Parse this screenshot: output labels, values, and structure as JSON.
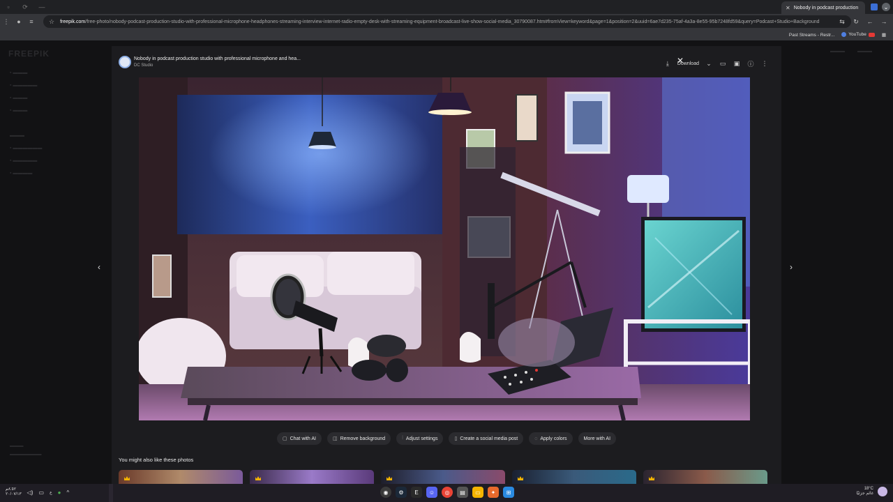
{
  "browser": {
    "active_tab": "Nobody in podcast production",
    "url_host": "freepik.com",
    "url_path": "/free-photo/nobody-podcast-production-studio-with-professional-microphone-headphones-streaming-interview-internet-radio-empty-desk-with-streaming-equipment-broadcast-live-show-social-media_30790087.htm#fromView=keyword&page=1&position=2&uuid=6ae7d235-75af-4a3a-8e55-95b7248fd59&query=Podcast+Studio+Background",
    "bookmarks": [
      "Past Streams - Restr...",
      "YouTube"
    ]
  },
  "modal": {
    "title": "Nobody in podcast production studio with professional microphone and hea...",
    "author": "DC Studio",
    "download_label": "Download",
    "ai_actions": [
      "Chat with AI",
      "Remove background",
      "Adjust settings",
      "Create a social media post",
      "Apply colors",
      "More with AI"
    ],
    "related_heading": "You might also like these photos"
  },
  "taskbar": {
    "clock_time": "٨:٥٢م",
    "clock_date": "٢٠/٠٧/١٣",
    "lang": "ع",
    "weather_temp": "18°C",
    "weather_desc": "غائم جزئيًا"
  },
  "colors": {
    "accent": "#3b6fd6",
    "modal_bg": "#1c1c1f",
    "crown": "#f5b400"
  }
}
